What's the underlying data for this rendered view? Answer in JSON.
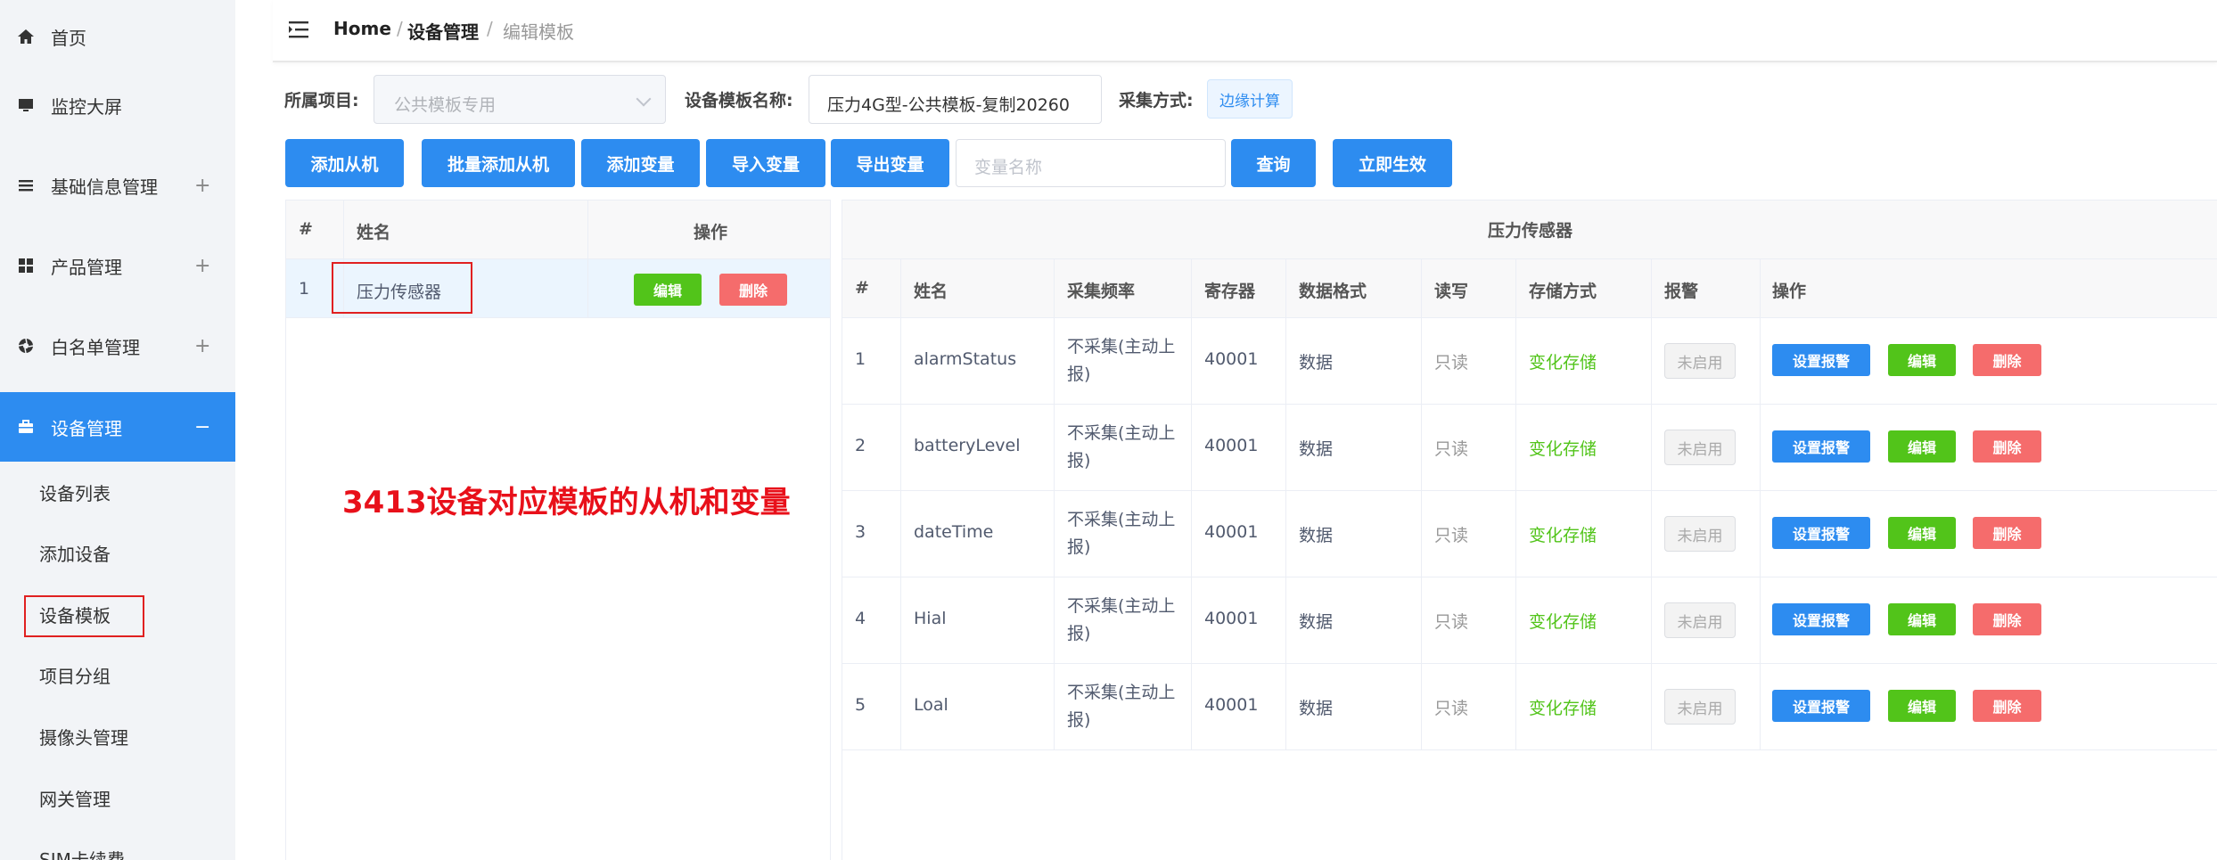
{
  "sidebar": {
    "items": [
      {
        "label": "首页",
        "icon": "home-icon",
        "toggle": ""
      },
      {
        "label": "监控大屏",
        "icon": "monitor-icon",
        "toggle": ""
      },
      {
        "label": "基础信息管理",
        "icon": "list-icon",
        "toggle": "+"
      },
      {
        "label": "产品管理",
        "icon": "grid-icon",
        "toggle": "+"
      },
      {
        "label": "白名单管理",
        "icon": "aperture-icon",
        "toggle": "+"
      },
      {
        "label": "设备管理",
        "icon": "briefcase-icon",
        "toggle": "−"
      }
    ],
    "subitems": [
      {
        "label": "设备列表"
      },
      {
        "label": "添加设备"
      },
      {
        "label": "设备模板"
      },
      {
        "label": "项目分组"
      },
      {
        "label": "摄像头管理"
      },
      {
        "label": "网关管理"
      },
      {
        "label": "SIM卡续费"
      }
    ]
  },
  "breadcrumb": {
    "home": "Home",
    "sep1": "/",
    "section": "设备管理",
    "sep2": "/",
    "current": "编辑模板"
  },
  "form": {
    "project_label": "所属项目:",
    "project_value": "公共模板专用",
    "name_label": "设备模板名称:",
    "name_value": "压力4G型-公共模板-复制20260",
    "method_label": "采集方式:",
    "method_value": "边缘计算"
  },
  "toolbar": {
    "add_slave": "添加从机",
    "batch_add_slave": "批量添加从机",
    "add_var": "添加变量",
    "import_var": "导入变量",
    "export_var": "导出变量",
    "search_placeholder": "变量名称",
    "query": "查询",
    "apply": "立即生效"
  },
  "slave_table": {
    "headers": {
      "index": "#",
      "name": "姓名",
      "ops": "操作"
    },
    "rows": [
      {
        "index": "1",
        "name": "压力传感器",
        "edit": "编辑",
        "delete": "删除"
      }
    ]
  },
  "annotation": "3413设备对应模板的从机和变量",
  "var_table": {
    "title": "压力传感器",
    "headers": {
      "index": "#",
      "name": "姓名",
      "freq": "采集频率",
      "register": "寄存器",
      "format": "数据格式",
      "rw": "读写",
      "storage": "存储方式",
      "alarm": "报警",
      "ops": "操作"
    },
    "rows": [
      {
        "index": "1",
        "name": "alarmStatus",
        "freq": "不采集(主动上报)",
        "register": "40001",
        "format": "数据",
        "rw": "只读",
        "storage": "变化存储",
        "alarm": "未启用",
        "set_alarm": "设置报警",
        "edit": "编辑",
        "delete": "删除"
      },
      {
        "index": "2",
        "name": "batteryLevel",
        "freq": "不采集(主动上报)",
        "register": "40001",
        "format": "数据",
        "rw": "只读",
        "storage": "变化存储",
        "alarm": "未启用",
        "set_alarm": "设置报警",
        "edit": "编辑",
        "delete": "删除"
      },
      {
        "index": "3",
        "name": "dateTime",
        "freq": "不采集(主动上报)",
        "register": "40001",
        "format": "数据",
        "rw": "只读",
        "storage": "变化存储",
        "alarm": "未启用",
        "set_alarm": "设置报警",
        "edit": "编辑",
        "delete": "删除"
      },
      {
        "index": "4",
        "name": "Hial",
        "freq": "不采集(主动上报)",
        "register": "40001",
        "format": "数据",
        "rw": "只读",
        "storage": "变化存储",
        "alarm": "未启用",
        "set_alarm": "设置报警",
        "edit": "编辑",
        "delete": "删除"
      },
      {
        "index": "5",
        "name": "Loal",
        "freq": "不采集(主动上报)",
        "register": "40001",
        "format": "数据",
        "rw": "只读",
        "storage": "变化存储",
        "alarm": "未启用",
        "set_alarm": "设置报警",
        "edit": "编辑",
        "delete": "删除"
      }
    ]
  },
  "colors": {
    "primary": "#2d8cf0",
    "success": "#52c41a",
    "danger": "#f56c6c",
    "annotation": "#e8101a",
    "highlight_border": "#e02020"
  }
}
